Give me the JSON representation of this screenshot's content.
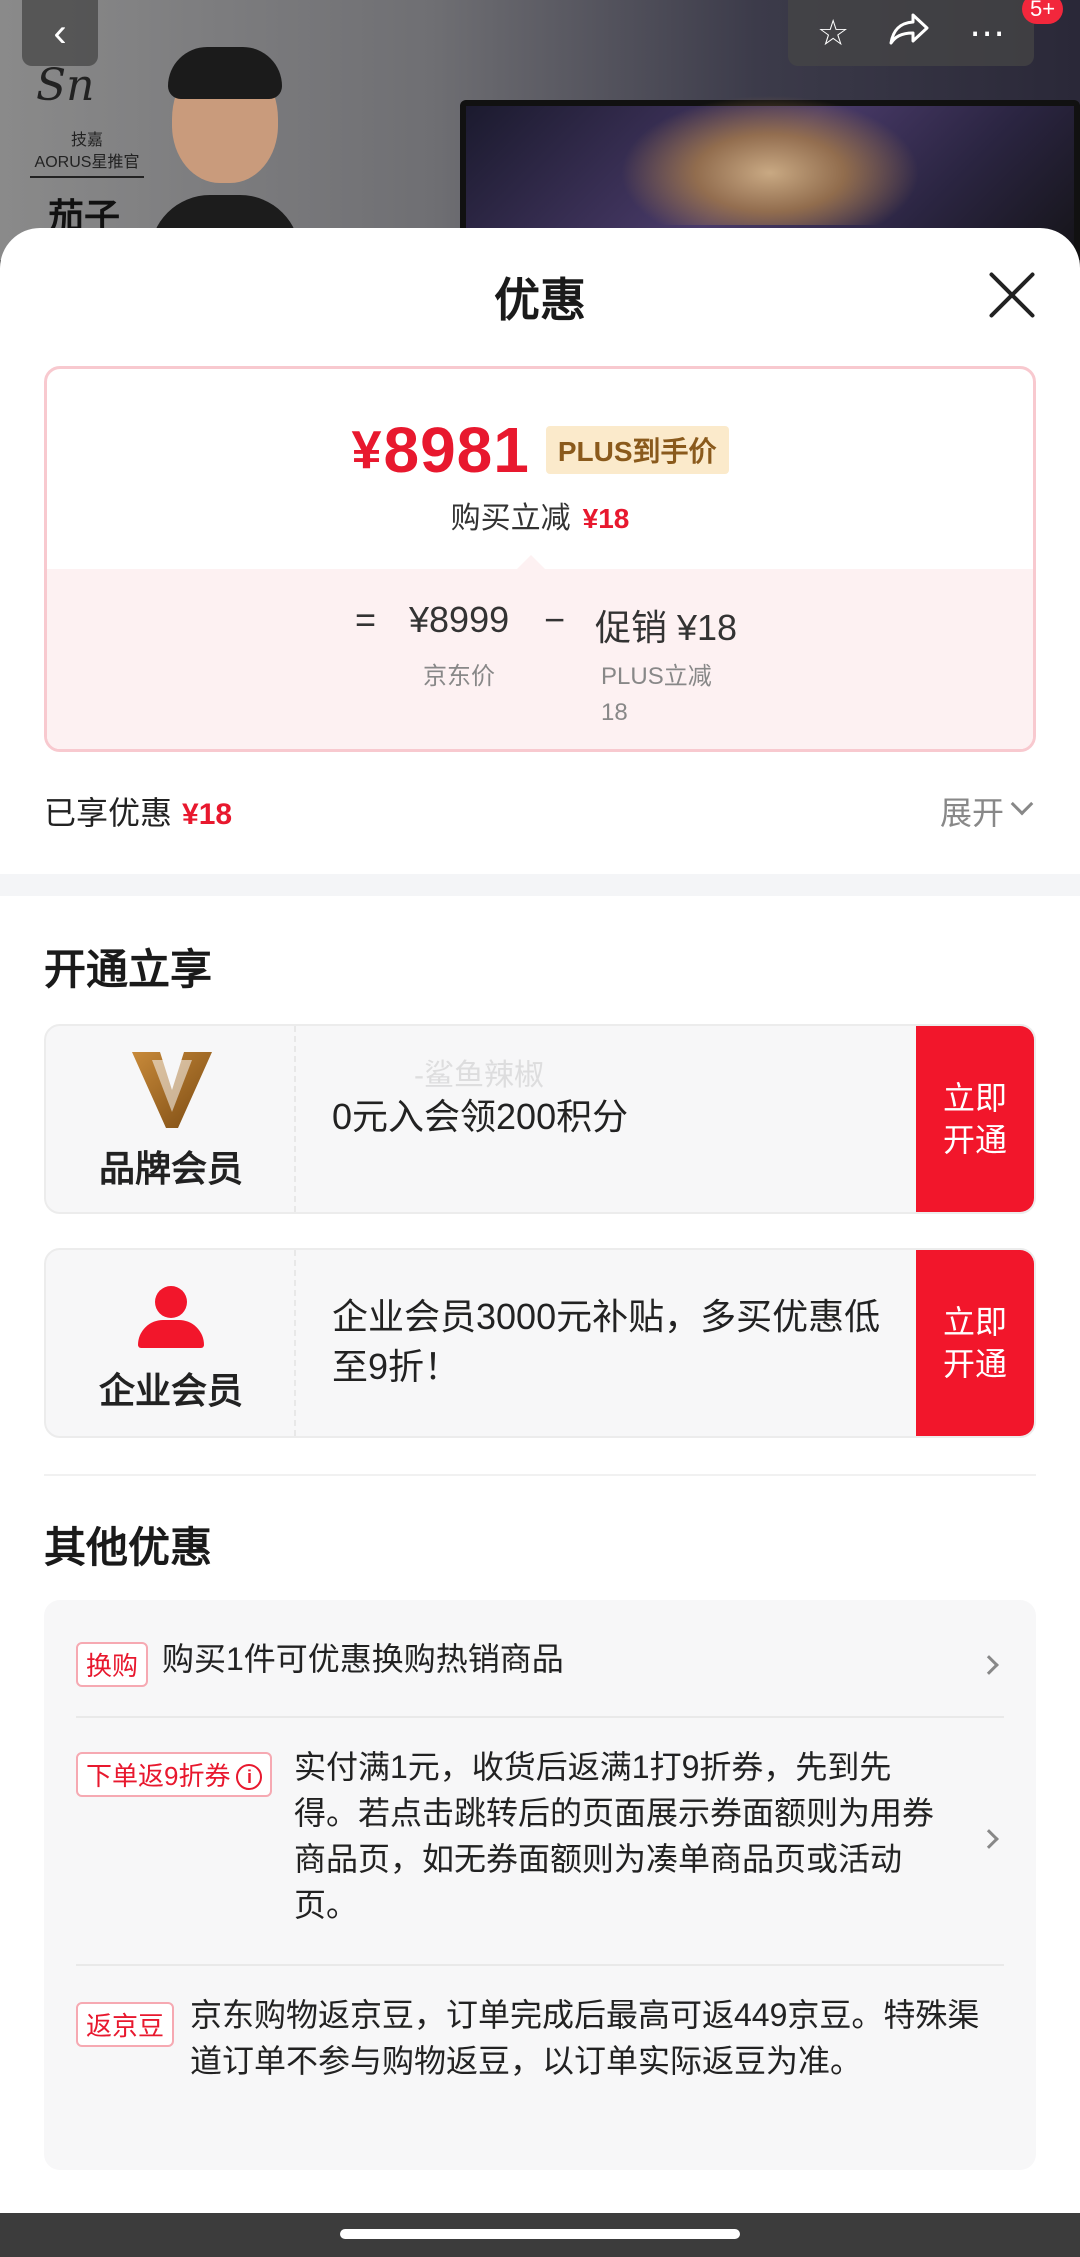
{
  "background": {
    "signature": "Sn",
    "brand_line1": "技嘉",
    "brand_line2": "AORUS星推官",
    "person_name": "茄子"
  },
  "top_actions": {
    "back_icon": "‹",
    "badge": "5+"
  },
  "sheet": {
    "title": "优惠",
    "price": {
      "currency": "¥",
      "amount": "8981",
      "plus_tag": "PLUS到手价",
      "discount_label": "购买立减",
      "discount_value": "¥18",
      "eq": "=",
      "jd_price": "¥8999",
      "minus": "−",
      "promo": "促销 ¥18",
      "jd_price_label": "京东价",
      "plus_reduce_label": "PLUS立减",
      "plus_reduce_value": "18"
    },
    "enjoyed_label": "已享优惠",
    "enjoyed_value": "¥18",
    "expand_label": "展开"
  },
  "open_section": {
    "title": "开通立享",
    "cards": [
      {
        "label": "品牌会员",
        "text": "0元入会领200积分",
        "button_line1": "立即",
        "button_line2": "开通"
      },
      {
        "label": "企业会员",
        "text": "企业会员3000元补贴，多买优惠低至9折！",
        "button_line1": "立即",
        "button_line2": "开通"
      }
    ]
  },
  "watermark": "-鲨鱼辣椒",
  "others_section": {
    "title": "其他优惠",
    "items": [
      {
        "tag": "换购",
        "text": "购买1件可优惠换购热销商品"
      },
      {
        "tag": "下单返9折券",
        "text": "实付满1元，收货后返满1打9折券，先到先得。若点击跳转后的页面展示券面额则为用券商品页，如无券面额则为凑单商品页或活动页。"
      },
      {
        "tag": "返京豆",
        "text": "京东购物返京豆，订单完成后最高可返449京豆。特殊渠道订单不参与购物返豆，以订单实际返豆为准。"
      }
    ]
  }
}
